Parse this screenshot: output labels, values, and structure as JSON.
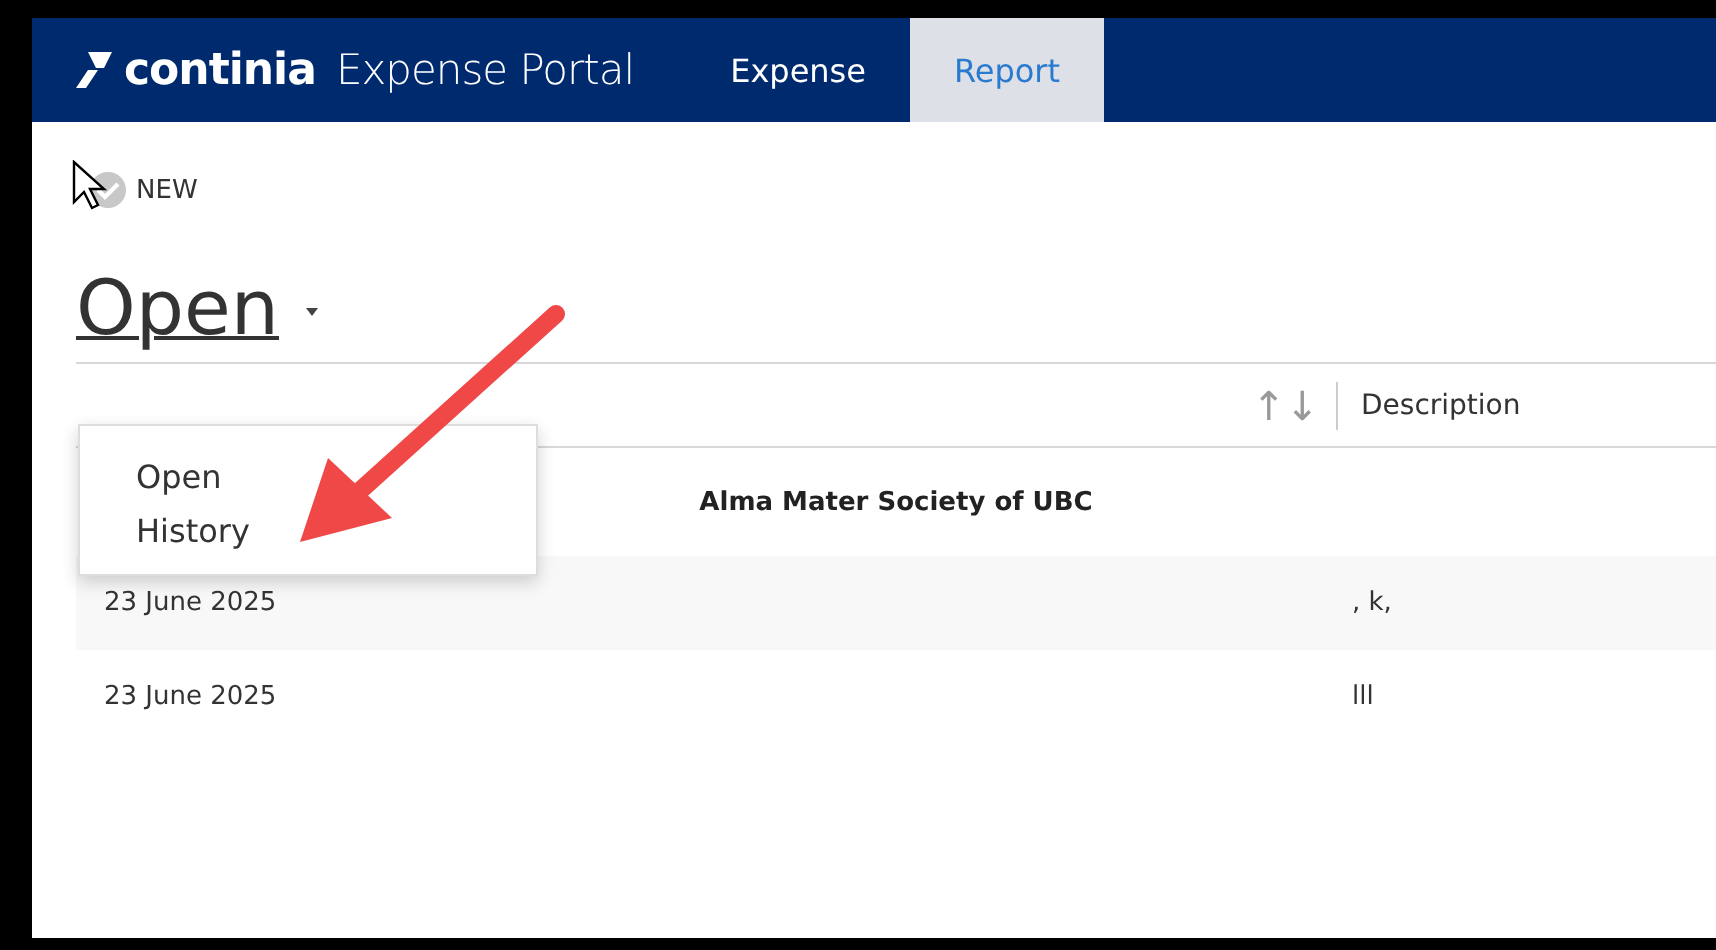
{
  "header": {
    "logo": "continia",
    "product": "Expense Portal",
    "tabs": [
      {
        "label": "Expense",
        "selected": false
      },
      {
        "label": "Report",
        "selected": true
      }
    ]
  },
  "toolbar": {
    "new_button": "NEW"
  },
  "view": {
    "title": "Open",
    "menu": [
      "Open",
      "History"
    ]
  },
  "table": {
    "sort_icon": "↑↓",
    "columns": [
      "Description"
    ],
    "group": "Alma Mater Society of UBC",
    "rows": [
      {
        "date": "23 June 2025",
        "description": ", k,"
      },
      {
        "date": "23 June 2025",
        "description": "lll"
      }
    ]
  }
}
